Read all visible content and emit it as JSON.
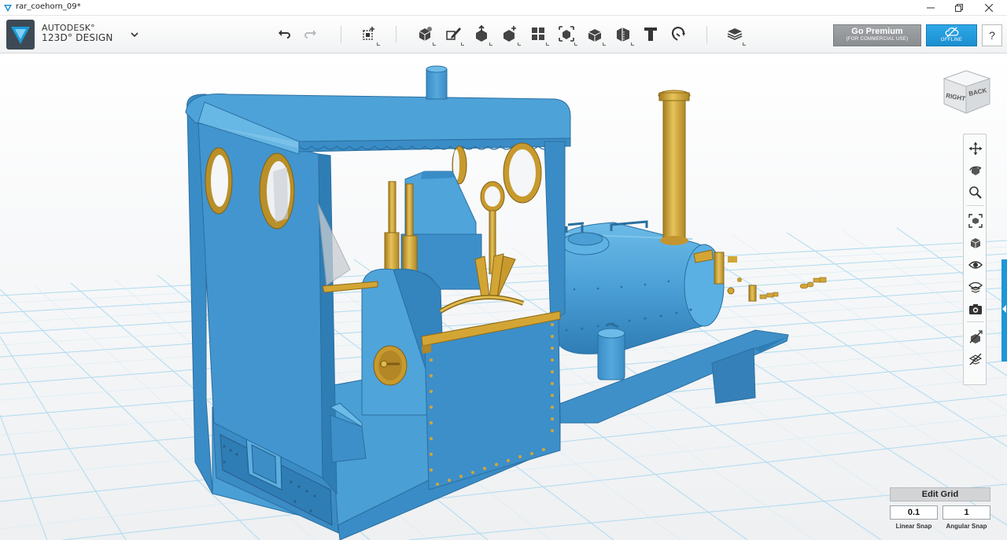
{
  "window": {
    "title": "rar_coehorn_09*",
    "controls": [
      "minimize",
      "restore",
      "close"
    ]
  },
  "brand": {
    "line1": "AUTODESK°",
    "line2": "123D° DESIGN"
  },
  "toolbar": {
    "items": [
      {
        "name": "undo-icon"
      },
      {
        "name": "redo-icon"
      },
      {
        "name": "transform-icon"
      },
      {
        "name": "primitives-icon"
      },
      {
        "name": "sketch-icon"
      },
      {
        "name": "construct-icon"
      },
      {
        "name": "modify-icon"
      },
      {
        "name": "pattern-icon"
      },
      {
        "name": "grouping-icon"
      },
      {
        "name": "combine-icon"
      },
      {
        "name": "measure-icon"
      },
      {
        "name": "text-icon"
      },
      {
        "name": "snap-icon"
      },
      {
        "name": "material-icon"
      }
    ]
  },
  "premium": {
    "label": "Go Premium",
    "sublabel": "(FOR COMMERCIAL USE)"
  },
  "offline": {
    "label": "OFFLINE"
  },
  "help": {
    "label": "?"
  },
  "viewcube": {
    "face_right": "RIGHT",
    "face_back": "BACK"
  },
  "nav": {
    "items": [
      "pan-icon",
      "orbit-icon",
      "zoom-icon",
      "fit-icon",
      "view-icon",
      "visibility-icon",
      "material-view-icon",
      "camera-icon",
      "solid-toggle-icon",
      "grid-toggle-icon"
    ]
  },
  "edit_grid": {
    "title": "Edit Grid",
    "linear_value": "0.1",
    "angular_value": "1",
    "linear_label": "Linear Snap",
    "angular_label": "Angular Snap"
  },
  "colors": {
    "model_blue": "#4b9fd5",
    "model_blue_dark": "#2f7db5",
    "brass": "#d3a535",
    "grid_line": "#a8d8ef",
    "accent": "#1e96d8"
  }
}
